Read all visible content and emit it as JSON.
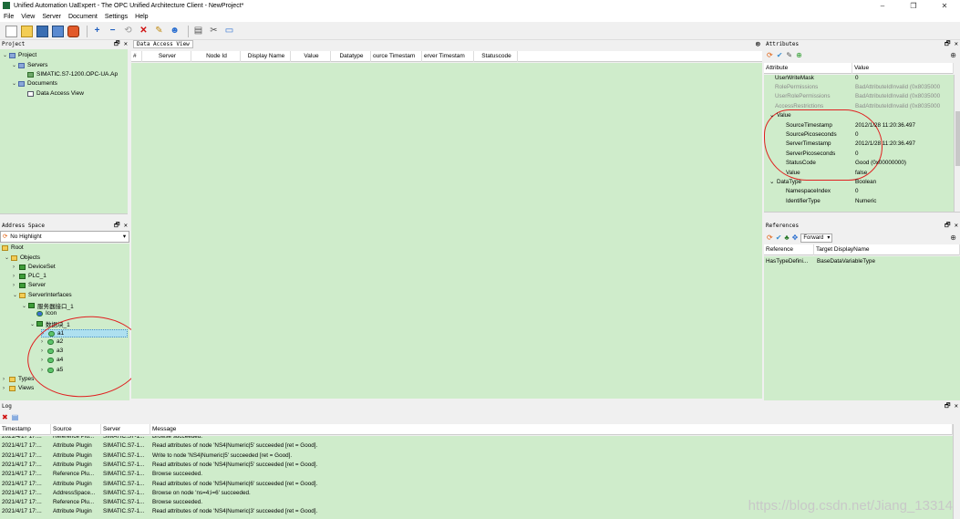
{
  "window": {
    "title": "Unified Automation UaExpert - The OPC Unified Architecture Client - NewProject*",
    "minimize": "–",
    "maximize": "❐",
    "close": "✕"
  },
  "menu": [
    "File",
    "View",
    "Server",
    "Document",
    "Settings",
    "Help"
  ],
  "toolbar": {
    "icons": [
      "new-icon",
      "open-icon",
      "save-icon",
      "save-as-icon",
      "settings-icon",
      "add-server-icon",
      "remove-server-icon",
      "connect-icon",
      "disconnect-icon",
      "discover-icon",
      "user-icon",
      "doc-icon",
      "delete-icon",
      "window-icon"
    ]
  },
  "project": {
    "title": "Project",
    "items": [
      "Project",
      "Servers",
      "SIMATIC.S7-1200.OPC-UA.Ap",
      "Documents",
      "Data Access View"
    ]
  },
  "address_space": {
    "title": "Address Space",
    "highlight": "No Highlight",
    "items": [
      "Root",
      "Objects",
      "DeviceSet",
      "PLC_1",
      "Server",
      "ServerInterfaces",
      "服务器接口_1",
      "Icon",
      "数据块_1",
      "a1",
      "a2",
      "a3",
      "a4",
      "a5",
      "Types",
      "Views"
    ]
  },
  "dav": {
    "tab": "Data Access View",
    "columns": [
      "#",
      "Server",
      "Node Id",
      "Display Name",
      "Value",
      "Datatype",
      "ource Timestam",
      "erver Timestam",
      "Statuscode"
    ]
  },
  "attributes": {
    "title": "Attributes",
    "col_attribute": "Attribute",
    "col_value": "Value",
    "rows": [
      {
        "k": "UserWriteMask",
        "v": "0",
        "dim": false,
        "indent": 1
      },
      {
        "k": "RolePermissions",
        "v": "BadAttributeIdInvalid (0x8035000",
        "dim": true,
        "indent": 1
      },
      {
        "k": "UserRolePermissions",
        "v": "BadAttributeIdInvalid (0x8035000",
        "dim": true,
        "indent": 1
      },
      {
        "k": "AccessRestrictions",
        "v": "BadAttributeIdInvalid (0x8035000",
        "dim": true,
        "indent": 1
      },
      {
        "k": "Value",
        "v": "",
        "dim": false,
        "indent": 0
      },
      {
        "k": "SourceTimestamp",
        "v": "2012/1/28 11:20:36.497",
        "dim": false,
        "indent": 2
      },
      {
        "k": "SourcePicoseconds",
        "v": "0",
        "dim": false,
        "indent": 2
      },
      {
        "k": "ServerTimestamp",
        "v": "2012/1/28 11:20:36.497",
        "dim": false,
        "indent": 2
      },
      {
        "k": "ServerPicoseconds",
        "v": "0",
        "dim": false,
        "indent": 2
      },
      {
        "k": "StatusCode",
        "v": "Good (0x00000000)",
        "dim": false,
        "indent": 2
      },
      {
        "k": "Value",
        "v": "false",
        "dim": false,
        "indent": 2
      },
      {
        "k": "DataType",
        "v": "Boolean",
        "dim": false,
        "indent": 0
      },
      {
        "k": "NamespaceIndex",
        "v": "0",
        "dim": false,
        "indent": 2
      },
      {
        "k": "IdentifierType",
        "v": "Numeric",
        "dim": false,
        "indent": 2
      }
    ]
  },
  "references": {
    "title": "References",
    "direction": "Forward",
    "col_reference": "Reference",
    "col_target": "Target DisplayName",
    "rows": [
      {
        "ref": "HasTypeDefini...",
        "target": "BaseDataVariableType"
      }
    ]
  },
  "log": {
    "title": "Log",
    "columns": [
      "Timestamp",
      "Source",
      "Server",
      "Message"
    ],
    "rows": [
      {
        "t": "2021/4/17 17:...",
        "s": "Reference Plu...",
        "srv": "SIMATIC.S7-1...",
        "m": "Browse succeeded."
      },
      {
        "t": "2021/4/17 17:...",
        "s": "Attribute Plugin",
        "srv": "SIMATIC.S7-1...",
        "m": "Read attributes of node 'NS4|Numeric|5' succeeded [ret = Good]."
      },
      {
        "t": "2021/4/17 17:...",
        "s": "Attribute Plugin",
        "srv": "SIMATIC.S7-1...",
        "m": "Write to node 'NS4|Numeric|5' succeeded [ret = Good]."
      },
      {
        "t": "2021/4/17 17:...",
        "s": "Attribute Plugin",
        "srv": "SIMATIC.S7-1...",
        "m": "Read attributes of node 'NS4|Numeric|5' succeeded [ret = Good]."
      },
      {
        "t": "2021/4/17 17:...",
        "s": "Reference Plu...",
        "srv": "SIMATIC.S7-1...",
        "m": "Browse succeeded."
      },
      {
        "t": "2021/4/17 17:...",
        "s": "Attribute Plugin",
        "srv": "SIMATIC.S7-1...",
        "m": "Read attributes of node 'NS4|Numeric|6' succeeded [ret = Good]."
      },
      {
        "t": "2021/4/17 17:...",
        "s": "AddressSpace...",
        "srv": "SIMATIC.S7-1...",
        "m": "Browse on node 'ns=4;i=6' succeeded."
      },
      {
        "t": "2021/4/17 17:...",
        "s": "Reference Plu...",
        "srv": "SIMATIC.S7-1...",
        "m": "Browse succeeded."
      },
      {
        "t": "2021/4/17 17:...",
        "s": "Attribute Plugin",
        "srv": "SIMATIC.S7-1...",
        "m": "Read attributes of node 'NS4|Numeric|3' succeeded [ret = Good]."
      }
    ]
  },
  "watermark": "https://blog.csdn.net/Jiang_13314",
  "colors": {
    "panel_green": "#cfeccb",
    "annotation_red": "#e02020"
  }
}
